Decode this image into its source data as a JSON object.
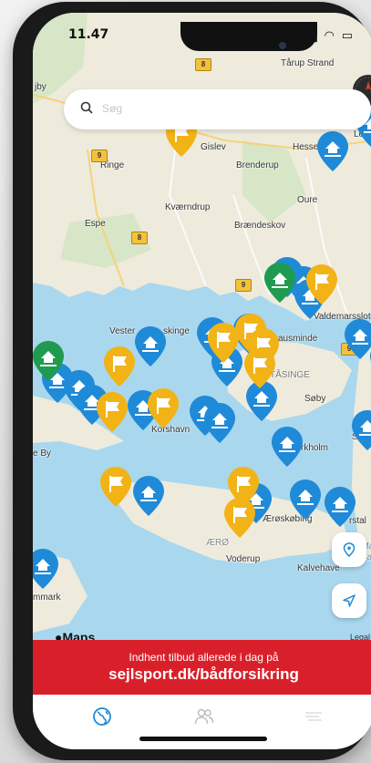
{
  "status_bar": {
    "time": "11.47",
    "icons": "▂▄▆ ◠ ▭"
  },
  "search": {
    "placeholder": "Søg"
  },
  "map": {
    "place_labels": [
      {
        "key": "tarup",
        "text": "Tårup Strand"
      },
      {
        "key": "jby",
        "text": "jby"
      },
      {
        "key": "loha",
        "text": "Loha"
      },
      {
        "key": "gislev",
        "text": "Gislev"
      },
      {
        "key": "hesse",
        "text": "Hesse"
      },
      {
        "key": "ringe",
        "text": "Ringe"
      },
      {
        "key": "brenderup",
        "text": "Brenderup"
      },
      {
        "key": "oure",
        "text": "Oure"
      },
      {
        "key": "kvaerndrup",
        "text": "Kværndrup"
      },
      {
        "key": "espe",
        "text": "Espe"
      },
      {
        "key": "braendeskov",
        "text": "Brændeskov"
      },
      {
        "key": "valdemarsslot",
        "text": "Valdemarsslot"
      },
      {
        "key": "vester",
        "text": "Vester"
      },
      {
        "key": "skinge",
        "text": "skinge"
      },
      {
        "key": "troense",
        "text": "zausminde"
      },
      {
        "key": "tasinge",
        "text": "TÅSINGE"
      },
      {
        "key": "saeby",
        "text": "Søby"
      },
      {
        "key": "korshavn",
        "text": "Korshavn"
      },
      {
        "key": "stryn",
        "text": "Stryn"
      },
      {
        "key": "eby",
        "text": "e By"
      },
      {
        "key": "rkholm",
        "text": "rkholm"
      },
      {
        "key": "eroskobing",
        "text": "Ærøskøbing"
      },
      {
        "key": "marstal",
        "text": "rstal"
      },
      {
        "key": "aero",
        "text": "ÆRØ"
      },
      {
        "key": "voderup",
        "text": "Voderup"
      },
      {
        "key": "kalvehave",
        "text": "Kalvehave"
      },
      {
        "key": "mmark",
        "text": "mmark"
      },
      {
        "key": "ma",
        "text": "Ma"
      },
      {
        "key": "ba",
        "text": "Ba"
      }
    ],
    "road_numbers": [
      "8",
      "9",
      "8",
      "9",
      "9",
      "9"
    ],
    "maps_logo": "Maps",
    "legal": "Legal"
  },
  "banner": {
    "line1": "Indhent tilbud allerede i dag på",
    "line2": "sejlsport.dk/bådforsikring"
  },
  "tabs": [
    {
      "icon": "globe-icon",
      "active": true
    },
    {
      "icon": "users-icon",
      "active": false
    },
    {
      "icon": "menu-icon",
      "active": false
    }
  ],
  "colors": {
    "water": "#a9d7ee",
    "land": "#f1eee4",
    "pin_blue": "#1f8ad8",
    "pin_yellow": "#f2b317",
    "pin_green": "#1f9b4f",
    "banner": "#d9202a",
    "accent_blue": "#1f8ad8"
  }
}
